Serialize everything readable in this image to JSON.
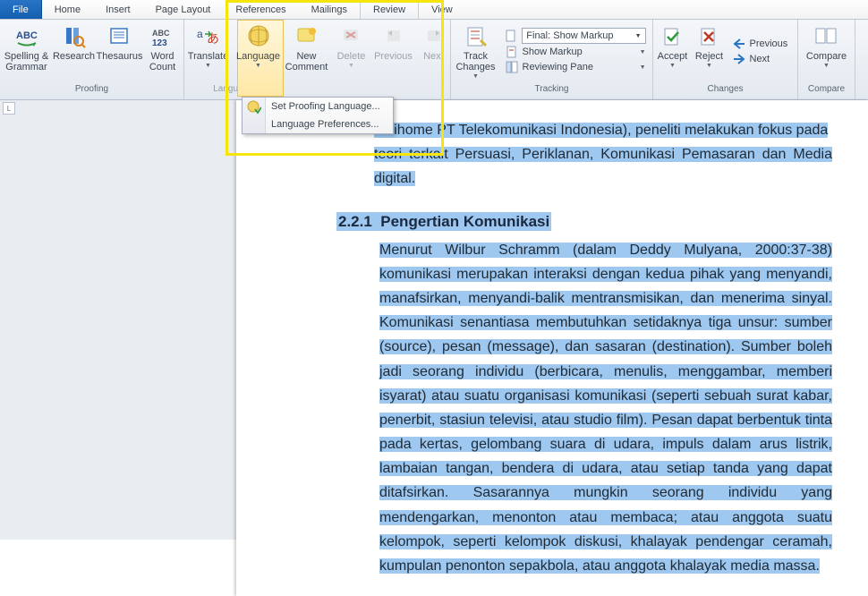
{
  "tabs": {
    "file": "File",
    "home": "Home",
    "insert": "Insert",
    "pagelayout": "Page Layout",
    "references": "References",
    "mailings": "Mailings",
    "review": "Review",
    "view": "View"
  },
  "ribbon": {
    "proofing": {
      "label": "Proofing",
      "spelling": "Spelling &\nGrammar",
      "research": "Research",
      "thesaurus": "Thesaurus",
      "wordcount": "Word\nCount"
    },
    "language": {
      "label": "Language",
      "translate": "Translate",
      "language_btn": "Language",
      "menu": {
        "set_proofing": "Set Proofing Language...",
        "prefs": "Language Preferences..."
      }
    },
    "comments": {
      "newcomment": "New\nComment",
      "delete": "Delete",
      "previous": "Previous",
      "next": "Next"
    },
    "tracking": {
      "label": "Tracking",
      "trackchanges": "Track\nChanges",
      "final": "Final: Show Markup",
      "show_markup": "Show Markup",
      "reviewing_pane": "Reviewing Pane"
    },
    "changes": {
      "label": "Changes",
      "accept": "Accept",
      "reject": "Reject",
      "previous": "Previous",
      "next": "Next"
    },
    "compare": {
      "label": "Compare",
      "compare_btn": "Compare"
    }
  },
  "ruler_corner": "L",
  "document": {
    "intro_line1": "Indihome PT Telekomunikasi Indonesia), peneliti melakukan fokus pada",
    "intro_line2": "teori terkait Persuasi, Periklanan, Komunikasi Pemasaran dan Media digital.",
    "section_num": "2.2.1",
    "section_title": "Pengertian Komunikasi",
    "body": "Menurut Wilbur Schramm (dalam Deddy Mulyana, 2000:37-38) komunikasi merupakan interaksi dengan kedua pihak yang menyandi, manafsirkan, menyandi-balik mentransmisikan, dan menerima sinyal. Komunikasi senantiasa membutuhkan setidaknya tiga unsur: sumber (source), pesan (message), dan sasaran (destination). Sumber boleh jadi seorang individu (berbicara, menulis, menggambar, memberi isyarat) atau suatu organisasi komunikasi (seperti sebuah surat kabar, penerbit, stasiun televisi, atau studio film). Pesan dapat berbentuk tinta pada kertas, gelombang suara di udara, impuls dalam arus listrik, lambaian tangan, bendera di udara, atau setiap tanda yang dapat ditafsirkan. Sasarannya mungkin seorang individu yang mendengarkan, menonton atau membaca; atau anggota suatu kelompok, seperti kelompok diskusi, khalayak pendengar ceramah, kumpulan penonton sepakbola, atau anggota khalayak media massa."
  }
}
